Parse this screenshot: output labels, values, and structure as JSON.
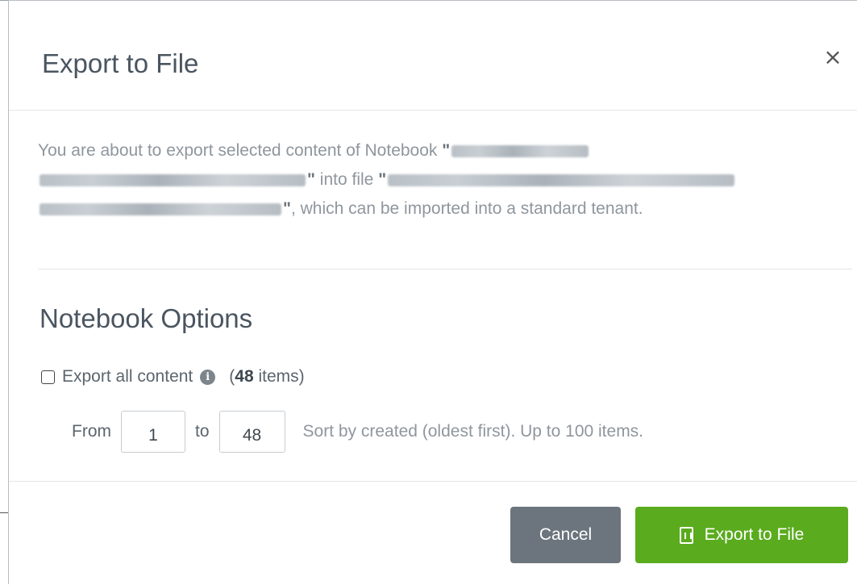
{
  "dialog": {
    "title": "Export to File",
    "close_glyph": "×",
    "description": {
      "part1": "You are about to export selected content of Notebook ",
      "part2": " into file ",
      "part3": ", which can be imported into a standard tenant.",
      "quote": "\""
    }
  },
  "options": {
    "section_title": "Notebook Options",
    "export_all_label": "Export all content",
    "export_all_checked": false,
    "info_glyph": "i",
    "count_open": "(",
    "count_value": "48",
    "count_suffix": " items)",
    "from_label": "From",
    "from_value": "1",
    "to_label": "to",
    "to_value": "48",
    "hint": "Sort by created (oldest first). Up to 100 items."
  },
  "footer": {
    "cancel_label": "Cancel",
    "export_label": "Export to File"
  },
  "colors": {
    "export_button": "#5aab1e",
    "cancel_button": "#6c757d",
    "title_text": "#4a5560",
    "muted_text": "#8f969d"
  },
  "icons": {
    "close": "close-icon",
    "info": "info-icon",
    "export": "file-archive-icon",
    "checkbox": "checkbox-unchecked"
  }
}
